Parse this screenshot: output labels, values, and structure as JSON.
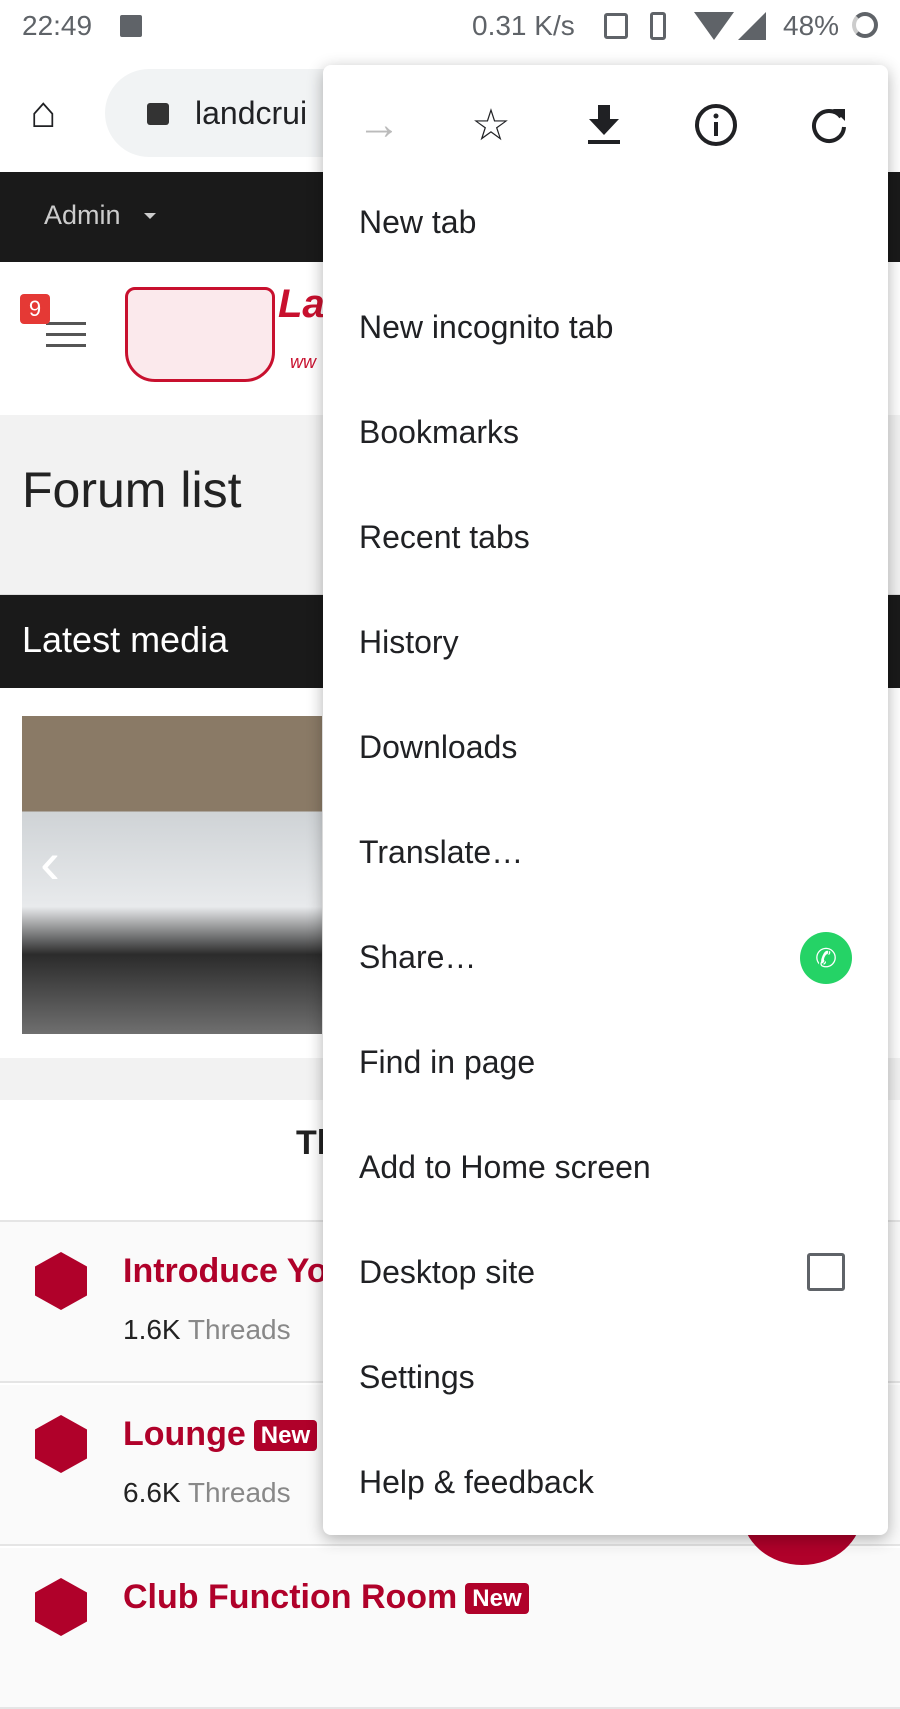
{
  "status": {
    "time": "22:49",
    "speed": "0.31 K/s",
    "battery": "48%"
  },
  "toolbar": {
    "url": "landcrui"
  },
  "nav": {
    "admin": "Admin"
  },
  "header": {
    "notif_count": "9",
    "logo_text": "La",
    "logo_sub": "ww"
  },
  "page": {
    "title": "Forum list",
    "latest_media": "Latest media",
    "section_heading": "Th"
  },
  "forums": [
    {
      "title": "Introduce Yo",
      "threads": "1.6K",
      "threads_label": "Threads",
      "badge": ""
    },
    {
      "title": "Lounge",
      "threads": "6.6K",
      "threads_label": "Threads",
      "badge": "New"
    },
    {
      "title": "Club Function Room",
      "threads": "",
      "threads_label": "",
      "badge": "New"
    }
  ],
  "menu": {
    "items": [
      "New tab",
      "New incognito tab",
      "Bookmarks",
      "Recent tabs",
      "History",
      "Downloads",
      "Translate…",
      "Share…",
      "Find in page",
      "Add to Home screen",
      "Desktop site",
      "Settings",
      "Help & feedback"
    ],
    "desktop_site_checked": false
  },
  "colors": {
    "brand": "#b0012a",
    "whatsapp": "#25d366"
  }
}
